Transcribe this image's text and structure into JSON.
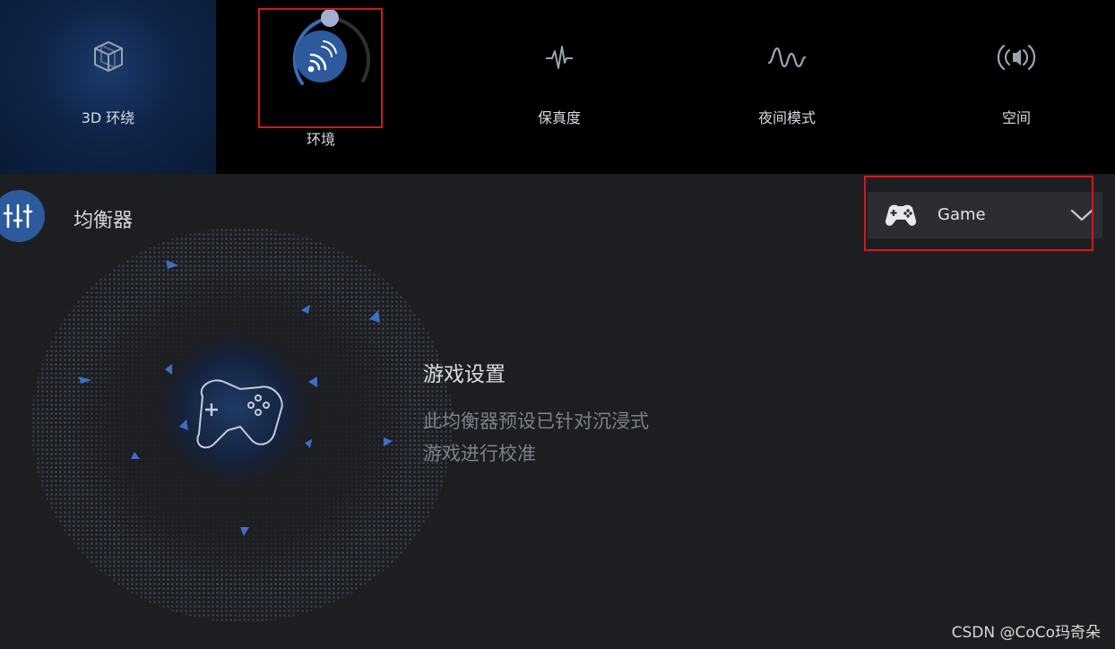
{
  "tabs": [
    {
      "id": "3d",
      "label": "3D 环绕",
      "icon": "cube-icon"
    },
    {
      "id": "ambient",
      "label": "环境",
      "icon": "ambient-sound-icon"
    },
    {
      "id": "fidelity",
      "label": "保真度",
      "icon": "waveform-icon"
    },
    {
      "id": "night",
      "label": "夜间模式",
      "icon": "night-wave-icon"
    },
    {
      "id": "space",
      "label": "空间",
      "icon": "broadcast-icon"
    }
  ],
  "equalizer": {
    "label": "均衡器",
    "icon": "sliders-icon",
    "preset": {
      "value": "Game",
      "icon": "gamepad-icon"
    }
  },
  "game_settings": {
    "title": "游戏设置",
    "description": "此均衡器预设已针对沉浸式游戏进行校准"
  },
  "ambient_dial_level": 0.55,
  "colors": {
    "accent": "#2c5a9c",
    "highlight_box": "#d0191d",
    "bg": "#1d1e22"
  },
  "watermark": "CSDN @CoCo玛奇朵"
}
